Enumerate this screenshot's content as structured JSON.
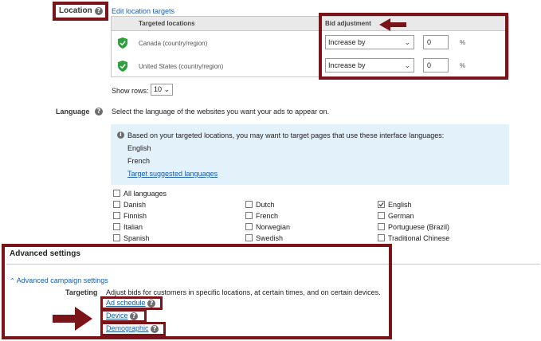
{
  "location": {
    "label": "Location",
    "edit_link": "Edit location targets",
    "table_headers": {
      "targeted": "Targeted locations",
      "bid": "Bid adjustment"
    },
    "rows": [
      {
        "name": "Canada (country/region)",
        "bid_type": "Increase by",
        "bid_value": "0",
        "unit": "%"
      },
      {
        "name": "United States (country/region)",
        "bid_type": "Increase by",
        "bid_value": "0",
        "unit": "%"
      }
    ],
    "show_rows_label": "Show rows:",
    "show_rows_value": "10"
  },
  "language": {
    "label": "Language",
    "description": "Select the language of the websites you want your ads to appear on.",
    "info_text": "Based on your targeted locations, you may want to target pages that use these interface languages:",
    "suggested": [
      "English",
      "French"
    ],
    "target_link": "Target suggested languages",
    "all_label": "All languages",
    "checkboxes": [
      {
        "label": "Danish",
        "checked": false
      },
      {
        "label": "Dutch",
        "checked": false
      },
      {
        "label": "English",
        "checked": true
      },
      {
        "label": "Finnish",
        "checked": false
      },
      {
        "label": "French",
        "checked": false
      },
      {
        "label": "German",
        "checked": false
      },
      {
        "label": "Italian",
        "checked": false
      },
      {
        "label": "Norwegian",
        "checked": false
      },
      {
        "label": "Portuguese (Brazil)",
        "checked": false
      },
      {
        "label": "Spanish",
        "checked": false
      },
      {
        "label": "Swedish",
        "checked": false
      },
      {
        "label": "Traditional Chinese",
        "checked": false
      }
    ]
  },
  "advanced": {
    "title": "Advanced settings",
    "toggle": "Advanced campaign settings",
    "targeting_label": "Targeting",
    "targeting_desc": "Adjust bids for customers in specific locations, at certain times, and on certain devices.",
    "links": [
      "Ad schedule",
      "Device",
      "Demographic"
    ]
  },
  "colors": {
    "annotation": "#7a1419",
    "link": "#1a5ea8",
    "check": "#2f9e3f"
  }
}
